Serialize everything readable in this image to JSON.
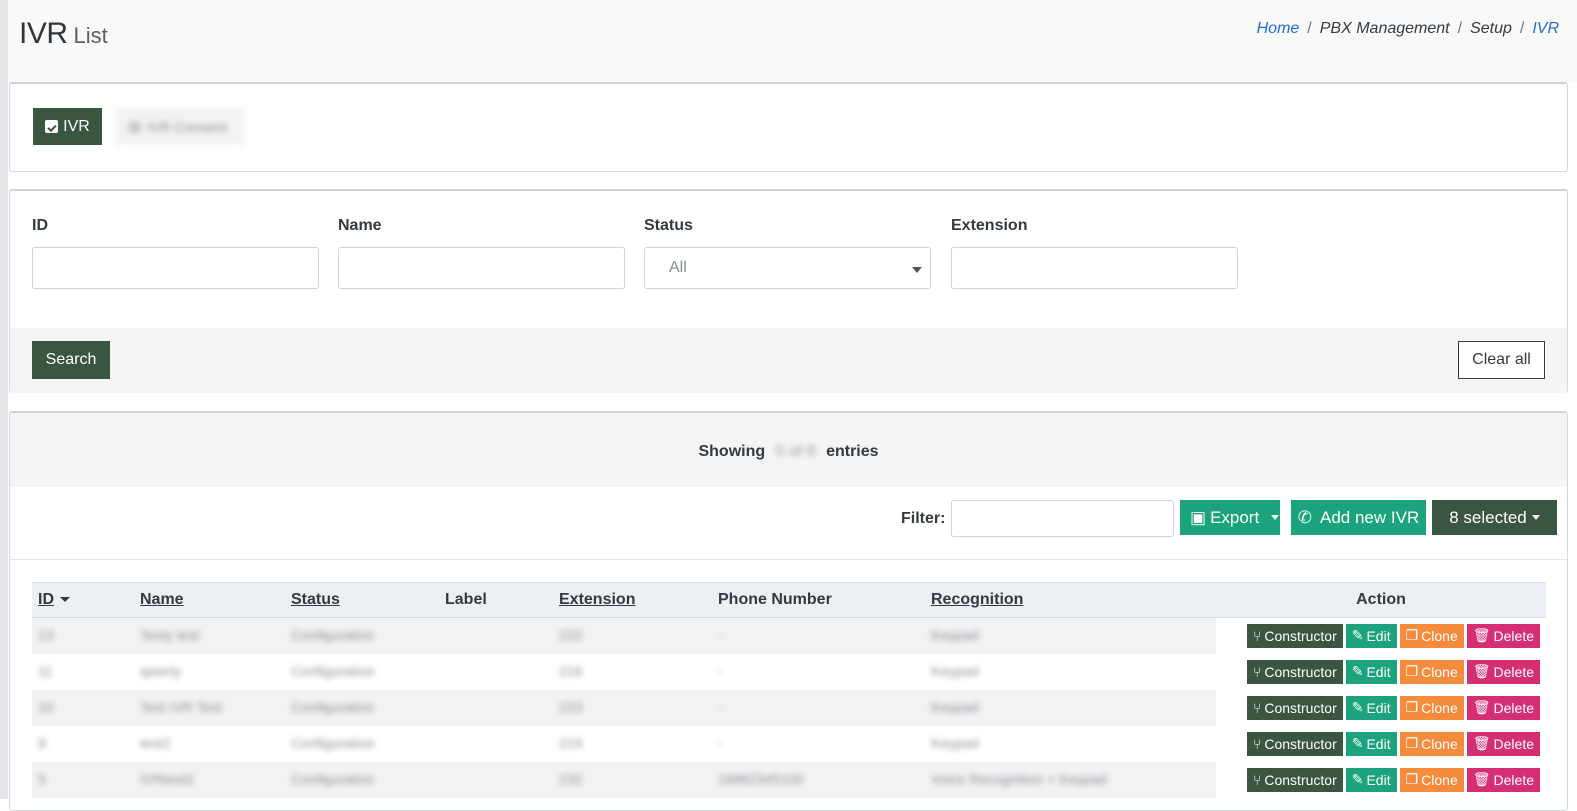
{
  "header": {
    "title_main": "IVR",
    "title_sub": "List",
    "breadcrumb": [
      "Home",
      "PBX Management",
      "Setup",
      "IVR"
    ]
  },
  "tabs": {
    "ivr_label": "IVR",
    "consent_label": "IVR Consent"
  },
  "filters": {
    "id_label": "ID",
    "name_label": "Name",
    "status_label": "Status",
    "status_value": "All",
    "extension_label": "Extension",
    "search_label": "Search",
    "clear_label": "Clear all"
  },
  "list": {
    "showing_prefix": "Showing",
    "showing_count": "5 of 8",
    "showing_suffix": "entries",
    "filter_label": "Filter:",
    "export_label": "Export",
    "add_label": "Add new IVR",
    "selected_label": "8 selected"
  },
  "table": {
    "columns": [
      "ID",
      "Name",
      "Status",
      "Label",
      "Extension",
      "Phone Number",
      "Recognition",
      "Action"
    ],
    "actions": [
      "Constructor",
      "Edit",
      "Clone",
      "Delete"
    ],
    "rows": [
      {
        "id": "13",
        "name": "Testy test",
        "status": "Configuration",
        "label": "",
        "extension": "222",
        "phone": "-",
        "recognition": "Keypad"
      },
      {
        "id": "11",
        "name": "qwerty",
        "status": "Configuration",
        "label": "",
        "extension": "216",
        "phone": "-",
        "recognition": "Keypad"
      },
      {
        "id": "10",
        "name": "Test IVR Test",
        "status": "Configuration",
        "label": "",
        "extension": "223",
        "phone": "-",
        "recognition": "Keypad"
      },
      {
        "id": "9",
        "name": "test2",
        "status": "Configuration",
        "label": "",
        "extension": "219",
        "phone": "-",
        "recognition": "Keypad"
      },
      {
        "id": "5",
        "name": "IVRtest2",
        "status": "Configuration",
        "label": "",
        "extension": "232",
        "phone": "18882345100",
        "recognition": "Voice Recognition + Keypad"
      }
    ]
  },
  "colors": {
    "primary_dark": "#3a5540",
    "accent_green": "#1aa37c",
    "clone_orange": "#f58b3d",
    "delete_pink": "#d42f73",
    "link_blue": "#1e6fc6"
  }
}
